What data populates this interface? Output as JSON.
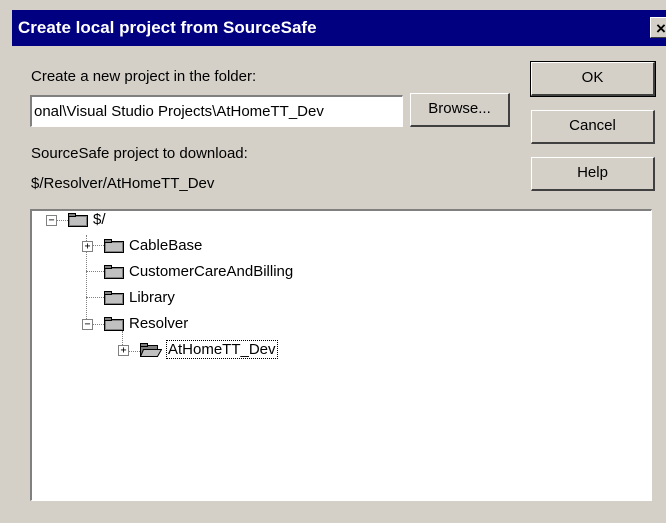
{
  "window": {
    "title": "Create local project from SourceSafe",
    "close_symbol": "×"
  },
  "folder": {
    "label": "Create a new project in the folder:",
    "value": "onal\\Visual Studio Projects\\AtHomeTT_Dev"
  },
  "buttons": {
    "browse": "Browse...",
    "ok": "OK",
    "cancel": "Cancel",
    "help": "Help"
  },
  "project": {
    "label": "SourceSafe project to download:",
    "path": "$/Resolver/AtHomeTT_Dev"
  },
  "tree": {
    "root": "$/",
    "items": [
      {
        "label": "CableBase",
        "expander": "+"
      },
      {
        "label": "CustomerCareAndBilling"
      },
      {
        "label": "Library"
      },
      {
        "label": "Resolver",
        "expander": "−"
      },
      {
        "label": "AtHomeTT_Dev",
        "expander": "+",
        "selected": true,
        "open_folder": true
      }
    ]
  }
}
